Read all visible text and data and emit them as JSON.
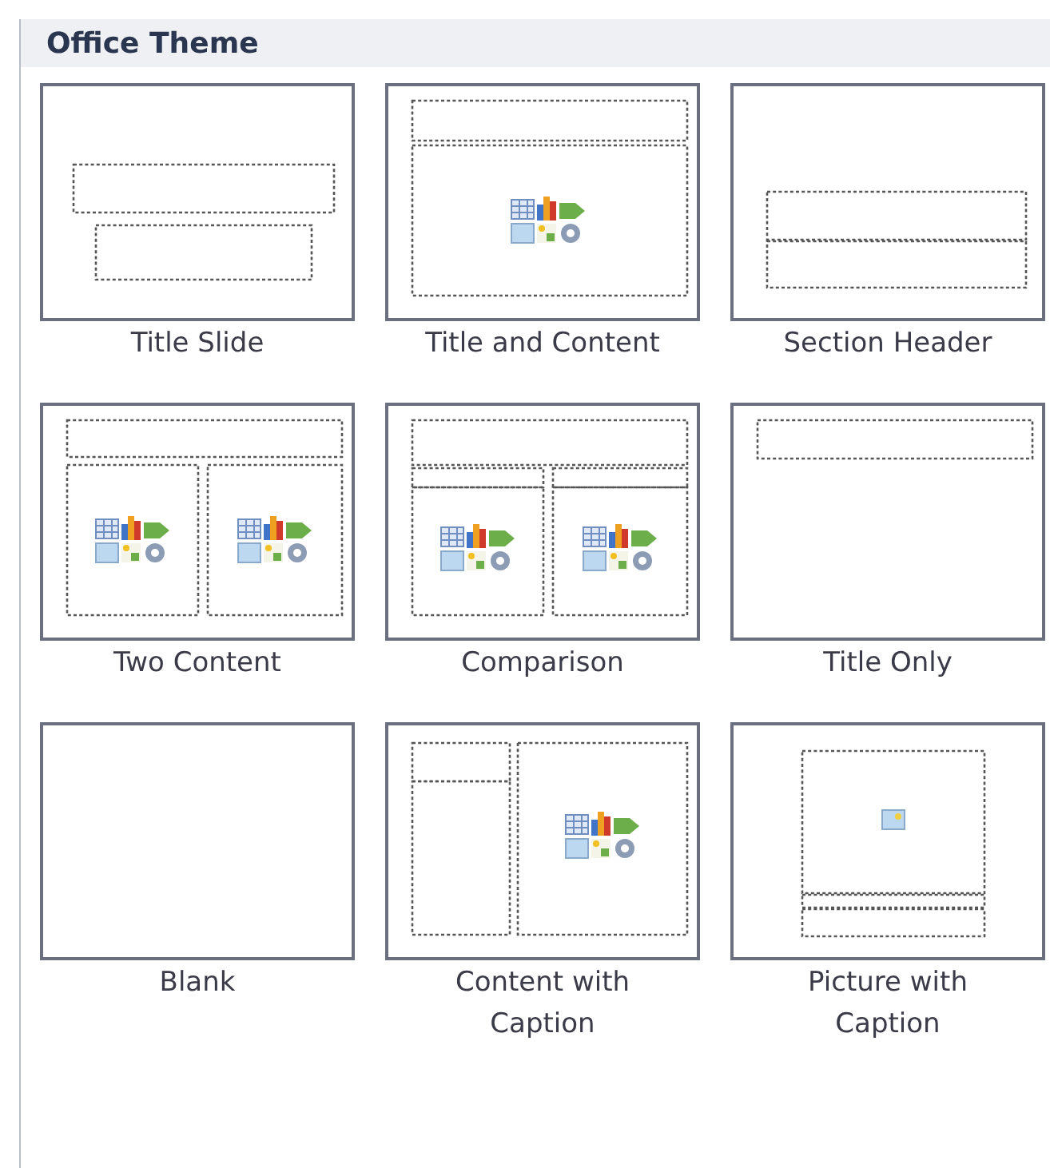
{
  "gallery": {
    "title": "Office Theme",
    "layouts": [
      {
        "label": "Title Slide",
        "kind": "title"
      },
      {
        "label": "Title and Content",
        "kind": "title-content"
      },
      {
        "label": "Section Header",
        "kind": "section"
      },
      {
        "label": "Two Content",
        "kind": "two-content"
      },
      {
        "label": "Comparison",
        "kind": "comparison"
      },
      {
        "label": "Title Only",
        "kind": "title-only"
      },
      {
        "label": "Blank",
        "kind": "blank"
      },
      {
        "label": "Content with Caption",
        "kind": "content-caption"
      },
      {
        "label": "Picture with Caption",
        "kind": "picture-caption"
      }
    ]
  }
}
